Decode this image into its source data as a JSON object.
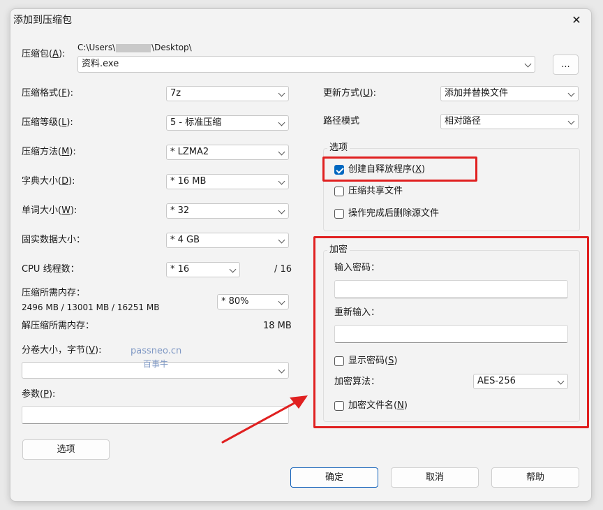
{
  "window": {
    "title": "添加到压缩包",
    "close_glyph": "✕"
  },
  "archive": {
    "label": "压缩包",
    "hotkey": "A",
    "label_suffix": "):",
    "path_prefix": "C:\\Users\\",
    "path_suffix": "\\Desktop\\",
    "filename": "资料.exe",
    "browse_label": "..."
  },
  "left": {
    "format": {
      "label": "压缩格式",
      "hotkey": "F",
      "value": "7z"
    },
    "level": {
      "label": "压缩等级",
      "hotkey": "L",
      "value": "5 - 标准压缩"
    },
    "method": {
      "label": "压缩方法",
      "hotkey": "M",
      "value": "* LZMA2"
    },
    "dict": {
      "label": "字典大小",
      "hotkey": "D",
      "value": "* 16 MB"
    },
    "word": {
      "label": "单词大小",
      "hotkey": "W",
      "value": "* 32"
    },
    "solid": {
      "label": "固实数据大小：",
      "value": "* 4 GB"
    },
    "threads": {
      "label": "CPU 线程数：",
      "value": "* 16",
      "max": "/ 16"
    },
    "mem": {
      "label": "压缩所需内存：",
      "detail": "2496 MB / 13001 MB / 16251 MB",
      "value": "* 80%"
    },
    "decomp": {
      "label": "解压缩所需内存：",
      "value": "18 MB"
    },
    "volume": {
      "label": "分卷大小，字节",
      "hotkey": "V",
      "value": ""
    },
    "params": {
      "label": "参数",
      "hotkey": "P",
      "value": ""
    },
    "options_button": "选项"
  },
  "watermark": {
    "line1": "passneo.cn",
    "line2": "百事牛"
  },
  "right": {
    "update": {
      "label": "更新方式",
      "hotkey": "U",
      "value": "添加并替换文件"
    },
    "pathmode": {
      "label": "路径模式",
      "value": "相对路径"
    },
    "options": {
      "title": "选项",
      "sfx": {
        "label": "创建自释放程序",
        "hotkey": "X",
        "checked": true
      },
      "shared": {
        "label": "压缩共享文件",
        "checked": false
      },
      "delete": {
        "label": "操作完成后删除源文件",
        "checked": false
      }
    },
    "encrypt": {
      "title": "加密",
      "enter_label": "输入密码：",
      "reenter_label": "重新输入：",
      "show": {
        "label": "显示密码",
        "hotkey": "S",
        "checked": false
      },
      "method_label": "加密算法：",
      "method_value": "AES-256",
      "names": {
        "label": "加密文件名",
        "hotkey": "N",
        "checked": false
      }
    }
  },
  "buttons": {
    "ok": "确定",
    "cancel": "取消",
    "help": "帮助"
  },
  "colors": {
    "highlight": "#e02020",
    "accent": "#0067c0",
    "watermark": "#7f98c4"
  }
}
